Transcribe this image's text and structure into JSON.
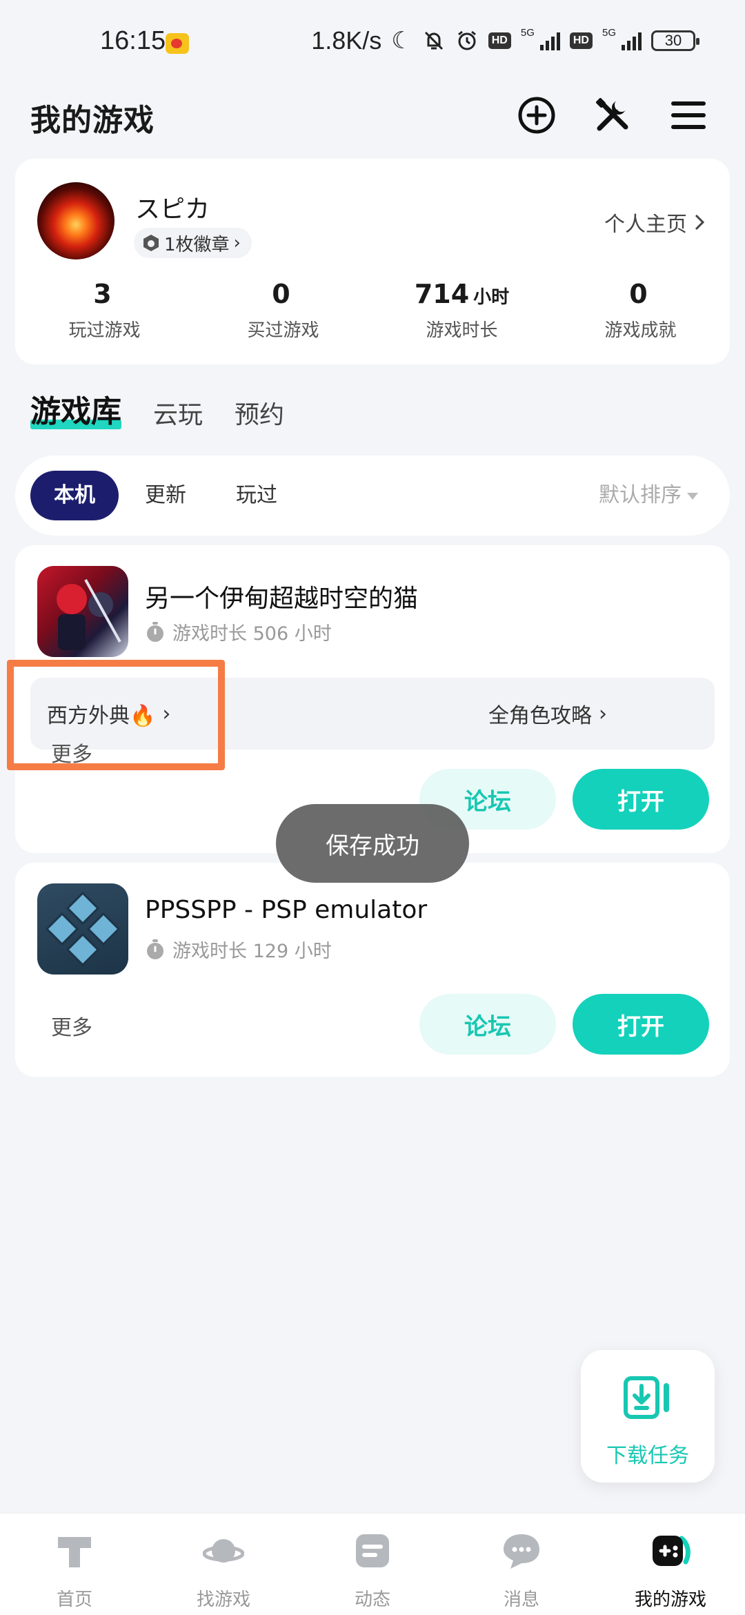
{
  "status_bar": {
    "time": "16:15",
    "speed": "1.8K/s",
    "battery": "30",
    "network_label": "5G",
    "hd_label": "HD"
  },
  "header": {
    "title": "我的游戏"
  },
  "profile": {
    "name": "スピカ",
    "badge": "1枚徽章",
    "link": "个人主页",
    "stats": [
      {
        "value": "3",
        "unit": "",
        "label": "玩过游戏"
      },
      {
        "value": "0",
        "unit": "",
        "label": "买过游戏"
      },
      {
        "value": "714",
        "unit": "小时",
        "label": "游戏时长"
      },
      {
        "value": "0",
        "unit": "",
        "label": "游戏成就"
      }
    ]
  },
  "tabs": [
    "游戏库",
    "云玩",
    "预约"
  ],
  "filters": {
    "chips": [
      "本机",
      "更新",
      "玩过"
    ],
    "sort": "默认排序"
  },
  "games": [
    {
      "title": "另一个伊甸超越时空的猫",
      "playtime": "游戏时长 506 小时",
      "guides": [
        "西方外典🔥",
        "全角色攻略"
      ],
      "more": "更多",
      "forum": "论坛",
      "open": "打开"
    },
    {
      "title": "PPSSPP - PSP emulator",
      "playtime": "游戏时长 129 小时",
      "more": "更多",
      "forum": "论坛",
      "open": "打开"
    }
  ],
  "toast": "保存成功",
  "download_fab": "下载任务",
  "bottom_nav": [
    {
      "label": "首页",
      "icon": "home-icon"
    },
    {
      "label": "找游戏",
      "icon": "planet-icon"
    },
    {
      "label": "动态",
      "icon": "feed-icon"
    },
    {
      "label": "消息",
      "icon": "chat-icon"
    },
    {
      "label": "我的游戏",
      "icon": "gamepad-icon"
    }
  ],
  "colors": {
    "accent": "#14d1bb",
    "chip_active": "#1c1e6d",
    "highlight": "#f57c45",
    "background": "#f4f5f8"
  }
}
